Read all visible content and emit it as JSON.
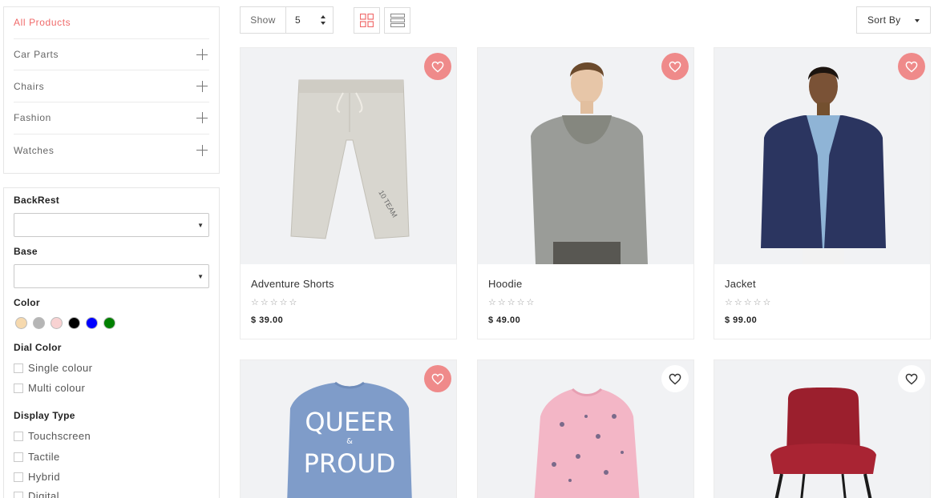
{
  "sidebar": {
    "categories": [
      {
        "label": "All Products",
        "active": true
      },
      {
        "label": "Car Parts",
        "expandable": true
      },
      {
        "label": "Chairs",
        "expandable": true
      },
      {
        "label": "Fashion",
        "expandable": true
      },
      {
        "label": "Watches",
        "expandable": true
      }
    ]
  },
  "filters": {
    "backrest_title": "BackRest",
    "backrest_value": "",
    "base_title": "Base",
    "base_value": "",
    "color_title": "Color",
    "colors": [
      "#f6d9ae",
      "#b5b5b5",
      "#f8d2d2",
      "#000000",
      "#0000ff",
      "#008000"
    ],
    "dial_color_title": "Dial Color",
    "dial_color_options": [
      "Single colour",
      "Multi colour"
    ],
    "display_type_title": "Display Type",
    "display_type_options": [
      "Touchscreen",
      "Tactile",
      "Hybrid",
      "Digital"
    ]
  },
  "toolbar": {
    "show_label": "Show",
    "show_value": "5",
    "grid_view_icon": "grid-icon",
    "list_view_icon": "list-icon",
    "sort_label": "Sort By"
  },
  "products": [
    {
      "name": "Adventure Shorts",
      "price": "$ 39.00",
      "stars": "☆☆☆☆☆",
      "wishlisted": true
    },
    {
      "name": "Hoodie",
      "price": "$ 49.00",
      "stars": "☆☆☆☆☆",
      "wishlisted": true
    },
    {
      "name": "Jacket",
      "price": "$ 99.00",
      "stars": "☆☆☆☆☆",
      "wishlisted": true
    },
    {
      "wishlisted": true,
      "image_text": "QUEER & PROUD"
    },
    {
      "wishlisted": false
    },
    {
      "wishlisted": false
    }
  ],
  "colors": {
    "accent": "#f06a6a",
    "heart_bg": "#ef8a8a",
    "card_bg": "#f1f2f4"
  }
}
